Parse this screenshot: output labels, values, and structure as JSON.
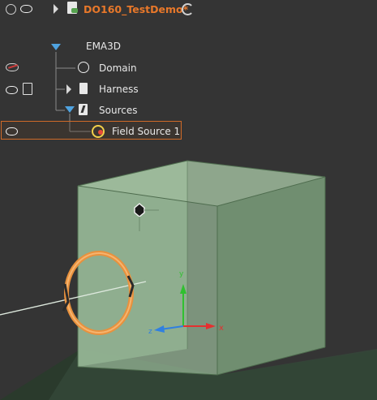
{
  "project": {
    "title": "DO160_TestDemo*"
  },
  "tree": {
    "root_label": "EMA3D",
    "items": [
      {
        "label": "Domain",
        "icon": "globe-icon"
      },
      {
        "label": "Harness",
        "icon": "harness-icon"
      },
      {
        "label": "Sources",
        "icon": "lightning-icon"
      }
    ],
    "selected_child": {
      "label": "Field Source 1",
      "icon": "field-source-icon"
    }
  },
  "axes": {
    "x_label": "x",
    "y_label": "y",
    "z_label": "z"
  },
  "colors": {
    "background": "#343434",
    "selection_border": "#d06a28",
    "title": "#e8782a",
    "tree_line": "#8a8a8a",
    "expand_arrow": "#4fa3e0",
    "box_fill": "#8fb28f",
    "loop": "#f0a050",
    "axis_x": "#e53030",
    "axis_y": "#30c030",
    "axis_z": "#3080e0"
  }
}
